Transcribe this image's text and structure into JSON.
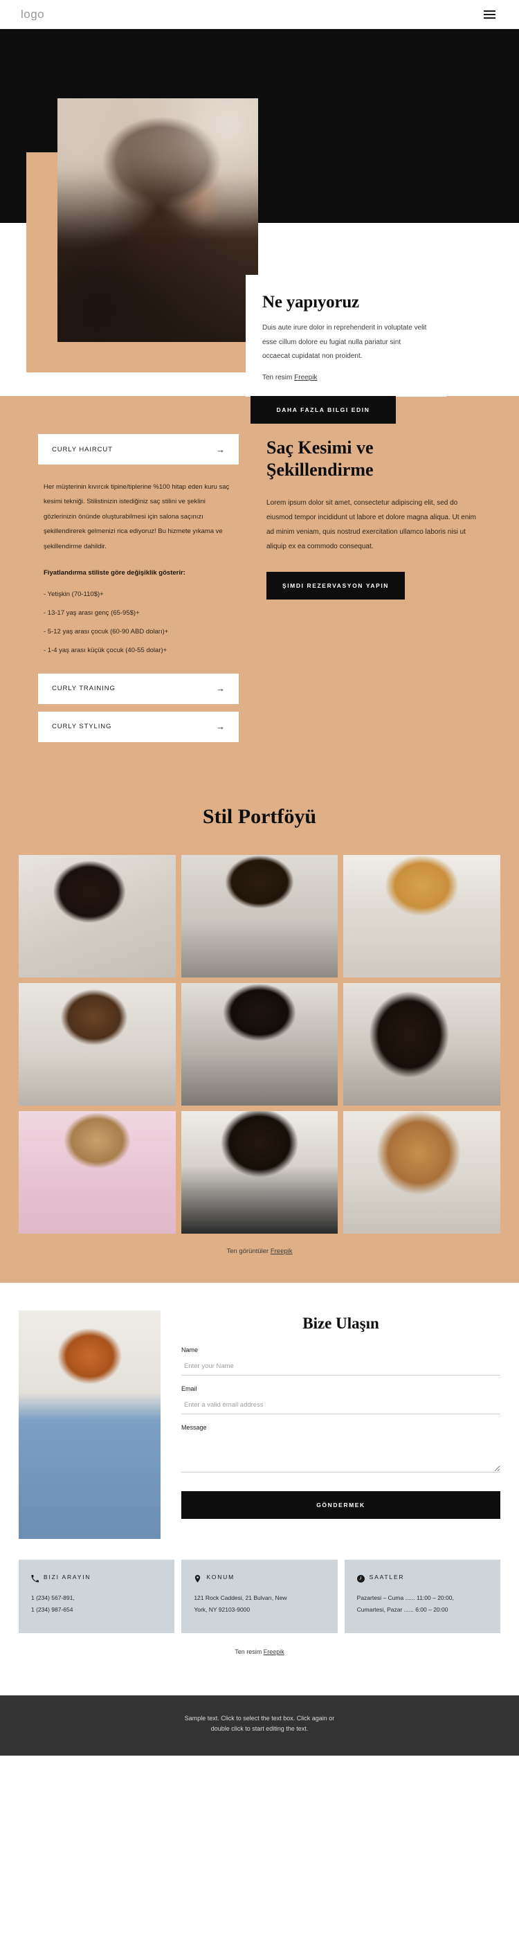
{
  "header": {
    "logo": "logo",
    "menu_icon": "hamburger-menu-icon"
  },
  "hero": {
    "title": "Ne yapıyoruz",
    "paragraph": "Duis aute irure dolor in reprehenderit in voluptate velit esse cillum dolore eu fugiat nulla pariatur sint occaecat cupidatat non proident.",
    "credit_prefix": "Ten resim ",
    "credit_link": "Freepik",
    "cta": "DAHA FAZLA BILGI EDIN"
  },
  "services": {
    "accordion_top": {
      "label": "CURLY HAIRCUT",
      "arrow": "→"
    },
    "body": "Her müşterinin kıvırcık tipine/tiplerine %100 hitap eden kuru saç kesimi tekniği. Stilistinizin istediğiniz saç stilini ve şeklini gözlerinizin önünde oluşturabilmesi için salona saçınızı şekillendirerek gelmenizi rica ediyoruz! Bu hizmete yıkama ve şekillendirme dahildir.",
    "pricing_heading": "Fiyatlandırma stiliste göre değişiklik gösterir:",
    "prices": [
      "- Yetişkin (70-110$)+",
      "- 13-17 yaş arası genç (65-95$)+",
      "- 5-12 yaş arası çocuk (60-90 ABD doları)+",
      "- 1-4 yaş arası küçük çocuk (40-55 dolar)+"
    ],
    "accordions": [
      {
        "label": "CURLY TRAINING",
        "arrow": "→"
      },
      {
        "label": "CURLY STYLING",
        "arrow": "→"
      }
    ],
    "right_title": "Saç Kesimi ve Şekillendirme",
    "right_paragraph": "Lorem ipsum dolor sit amet, consectetur adipiscing elit, sed do eiusmod tempor incididunt ut labore et dolore magna aliqua. Ut enim ad minim veniam, quis nostrud exercitation ullamco laboris nisi ut aliquip ex ea commodo consequat.",
    "right_cta": "ŞIMDI REZERVASYON YAPIN"
  },
  "portfolio": {
    "title": "Stil Portföyü",
    "images": [
      "portfolio-photo-1",
      "portfolio-photo-2",
      "portfolio-photo-3",
      "portfolio-photo-4",
      "portfolio-photo-5",
      "portfolio-photo-6",
      "portfolio-photo-7",
      "portfolio-photo-8",
      "portfolio-photo-9"
    ],
    "credit_prefix": "Ten görüntüler ",
    "credit_link": "Freepik"
  },
  "contact": {
    "title": "Bize Ulaşın",
    "fields": [
      {
        "label": "Name",
        "placeholder": "Enter your Name",
        "value": ""
      },
      {
        "label": "Email",
        "placeholder": "Enter a valid email address",
        "value": ""
      },
      {
        "label": "Message",
        "placeholder": "",
        "value": ""
      }
    ],
    "submit": "GÖNDERMEK"
  },
  "info": {
    "cards": [
      {
        "icon": "phone-icon",
        "title": "BIZI ARAYIN",
        "lines": [
          "1 (234) 567-891,",
          "1 (234) 987-654"
        ]
      },
      {
        "icon": "map-pin-icon",
        "title": "KONUM",
        "lines": [
          "121 Rock Caddesi, 21 Bulvarı, New",
          "York, NY 92103-9000"
        ]
      },
      {
        "icon": "clock-icon",
        "title": "SAATLER",
        "lines": [
          "Pazartesi – Cuma ...... 11:00 – 20:00,",
          "Cumartesi, Pazar ...... 6:00 – 20:00"
        ]
      }
    ],
    "credit_prefix": "Ten resim ",
    "credit_link": "Freepik"
  },
  "footer": {
    "line1": "Sample text. Click to select the text box. Click again or",
    "line2": "double click to start editing the text."
  },
  "colors": {
    "tan": "#dfb088",
    "dark": "#0d0d0d",
    "info_card": "#cdd4da",
    "footer": "#333333"
  }
}
